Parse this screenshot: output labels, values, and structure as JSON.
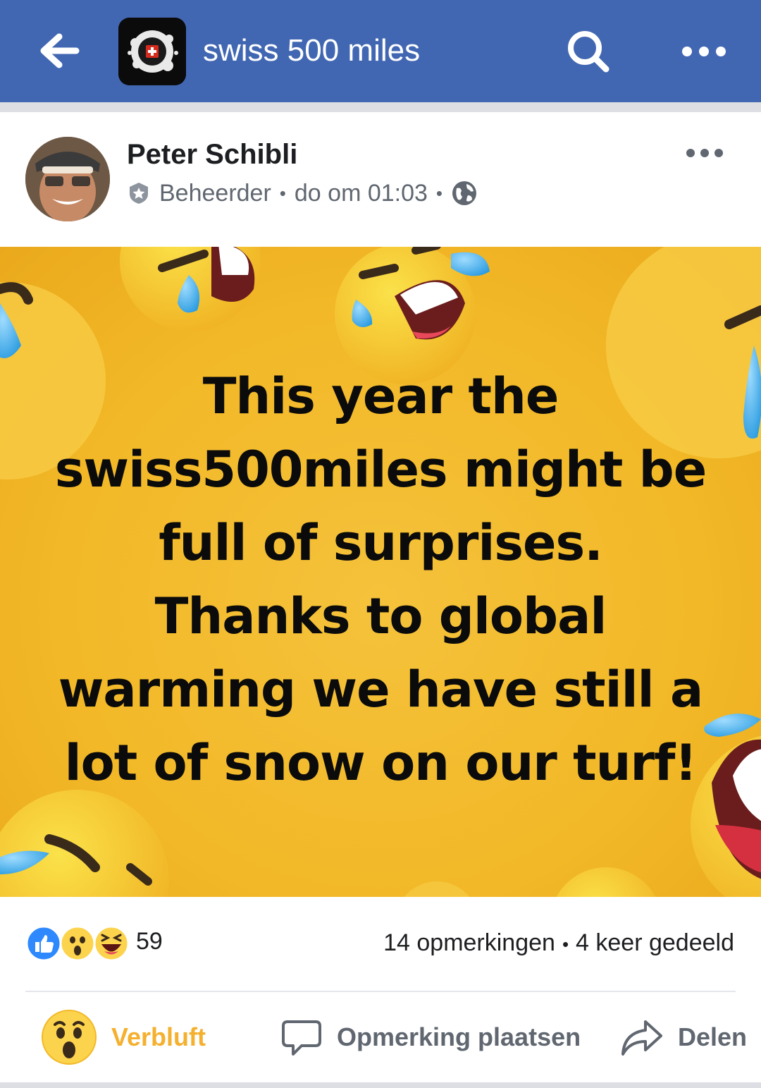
{
  "appbar": {
    "title": "swiss 500 miles",
    "background": "#4267b2",
    "back_icon": "arrow-left-icon",
    "search_icon": "search-icon",
    "more_icon": "more-horizontal-icon"
  },
  "post": {
    "author": "Peter Schibli",
    "role": "Beheerder",
    "timestamp": "do om 01:03",
    "privacy_icon": "globe-icon",
    "image_text": "This year the\nswiss500miles might be\nfull of surprises.\nThanks to global\nwarming we have still a\nlot of snow on our turf!",
    "image_background": "#f2b827"
  },
  "summary": {
    "reaction_icons": [
      "like-icon",
      "wow-icon",
      "haha-icon"
    ],
    "reaction_count": "59",
    "comments": "14 opmerkingen",
    "shares": "4 keer gedeeld"
  },
  "actions": {
    "reaction_label": "Verbluft",
    "comment_label": "Opmerking plaatsen",
    "share_label": "Delen",
    "reaction_color": "#f4b02e"
  }
}
